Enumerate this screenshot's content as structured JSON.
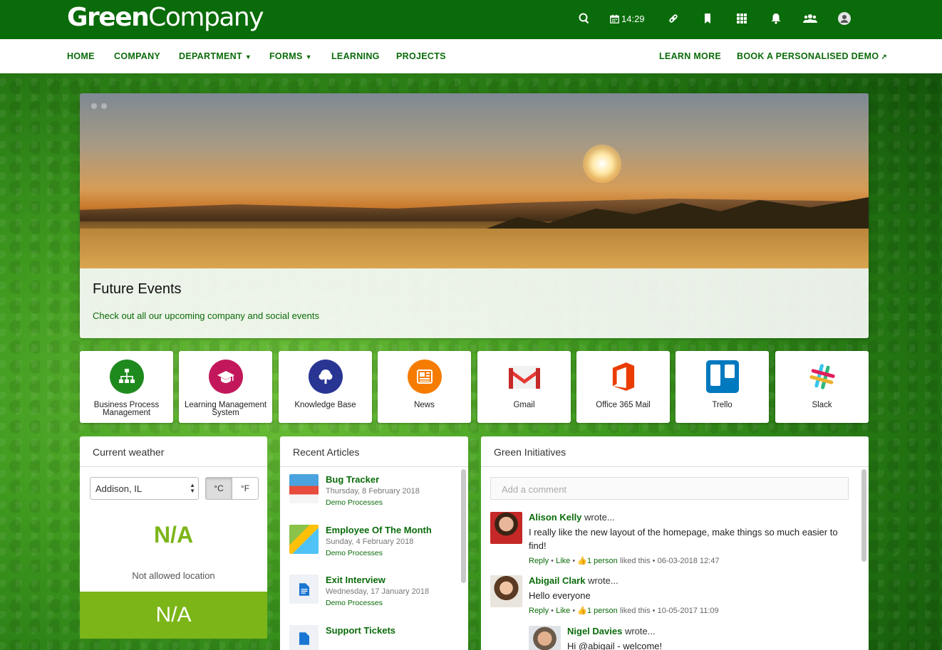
{
  "brand": {
    "bold": "Green",
    "regular": "Company"
  },
  "topbar": {
    "time": "14:29",
    "icons": [
      "search-icon",
      "calendar-icon",
      "link-icon",
      "bookmark-icon",
      "apps-grid-icon",
      "bell-icon",
      "people-icon",
      "user-icon"
    ]
  },
  "nav": {
    "left": [
      "HOME",
      "COMPANY",
      "DEPARTMENT",
      "FORMS",
      "LEARNING",
      "PROJECTS"
    ],
    "right": [
      "LEARN MORE",
      "BOOK A PERSONALISED DEMO"
    ]
  },
  "hero": {
    "title": "Future Events",
    "subtitle": "Check out all our upcoming company and social events"
  },
  "apps": [
    {
      "label": "Business Process Management",
      "color": "#1e8a1e"
    },
    {
      "label": "Learning Management System",
      "color": "#c2185b"
    },
    {
      "label": "Knowledge Base",
      "color": "#283593"
    },
    {
      "label": "News",
      "color": "#f57c00"
    },
    {
      "label": "Gmail",
      "color": "#d93025"
    },
    {
      "label": "Office 365 Mail",
      "color": "#eb3c00"
    },
    {
      "label": "Trello",
      "color": "#0079bf"
    },
    {
      "label": "Slack",
      "color": "#4a154b"
    }
  ],
  "weather": {
    "title": "Current weather",
    "location": "Addison, IL",
    "unit_c": "°C",
    "unit_f": "°F",
    "value": "N/A",
    "message": "Not allowed location",
    "band_value": "N/A"
  },
  "articles": {
    "title": "Recent Articles",
    "items": [
      {
        "title": "Bug Tracker",
        "date": "Thursday, 8 February 2018",
        "category": "Demo Processes"
      },
      {
        "title": "Employee Of The Month",
        "date": "Sunday, 4 February 2018",
        "category": "Demo Processes"
      },
      {
        "title": "Exit Interview",
        "date": "Wednesday, 17 January 2018",
        "category": "Demo Processes"
      },
      {
        "title": "Support Tickets",
        "date": "",
        "category": ""
      }
    ]
  },
  "initiatives": {
    "title": "Green Initiatives",
    "placeholder": "Add a comment",
    "wrote": "wrote...",
    "reply": "Reply",
    "like": "Like",
    "liked_suffix": "liked this",
    "posts": [
      {
        "author": "Alison Kelly",
        "text": "I really like the new layout of the homepage, make things so much easier to find!",
        "likes": "1 person",
        "timestamp": "06-03-2018 12:47"
      },
      {
        "author": "Abigail Clark",
        "text": "Hello everyone",
        "likes": "1 person",
        "timestamp": "10-05-2017 11:09"
      },
      {
        "author": "Nigel Davies",
        "text": "Hi @abigail - welcome!",
        "likes": "",
        "timestamp": ""
      }
    ]
  }
}
